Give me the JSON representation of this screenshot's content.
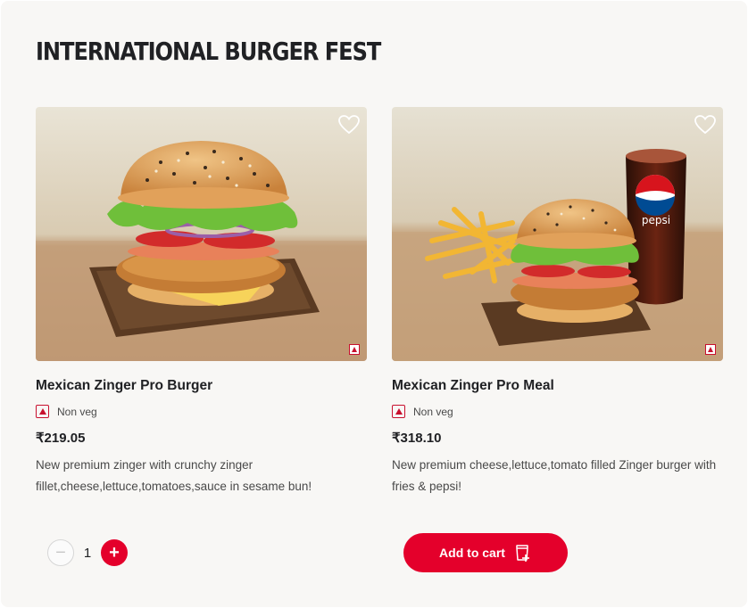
{
  "section": {
    "title": "INTERNATIONAL BURGER FEST"
  },
  "products": [
    {
      "name": "Mexican Zinger Pro Burger",
      "veg_label": "Non veg",
      "price": "₹219.05",
      "description": "New premium zinger with crunchy zinger fillet,cheese,lettuce,tomatoes,sauce in sesame bun!",
      "favorite_icon": "heart-outline-icon",
      "image_icon": "burger-photo"
    },
    {
      "name": "Mexican Zinger Pro Meal",
      "veg_label": "Non veg",
      "price": "₹318.10",
      "description": "New premium cheese,lettuce,tomato filled Zinger burger with fries & pepsi!",
      "favorite_icon": "heart-outline-icon",
      "image_icon": "meal-photo",
      "drink_brand": "pepsi"
    }
  ],
  "quantity": {
    "value": "1",
    "minus_label": "−",
    "plus_label": "+"
  },
  "cart": {
    "label": "Add to cart",
    "icon": "cart-add-icon"
  },
  "colors": {
    "accent": "#e4002b",
    "non_veg": "#c8102e",
    "background": "#f8f7f5",
    "text": "#202124",
    "muted_text": "#494949"
  }
}
